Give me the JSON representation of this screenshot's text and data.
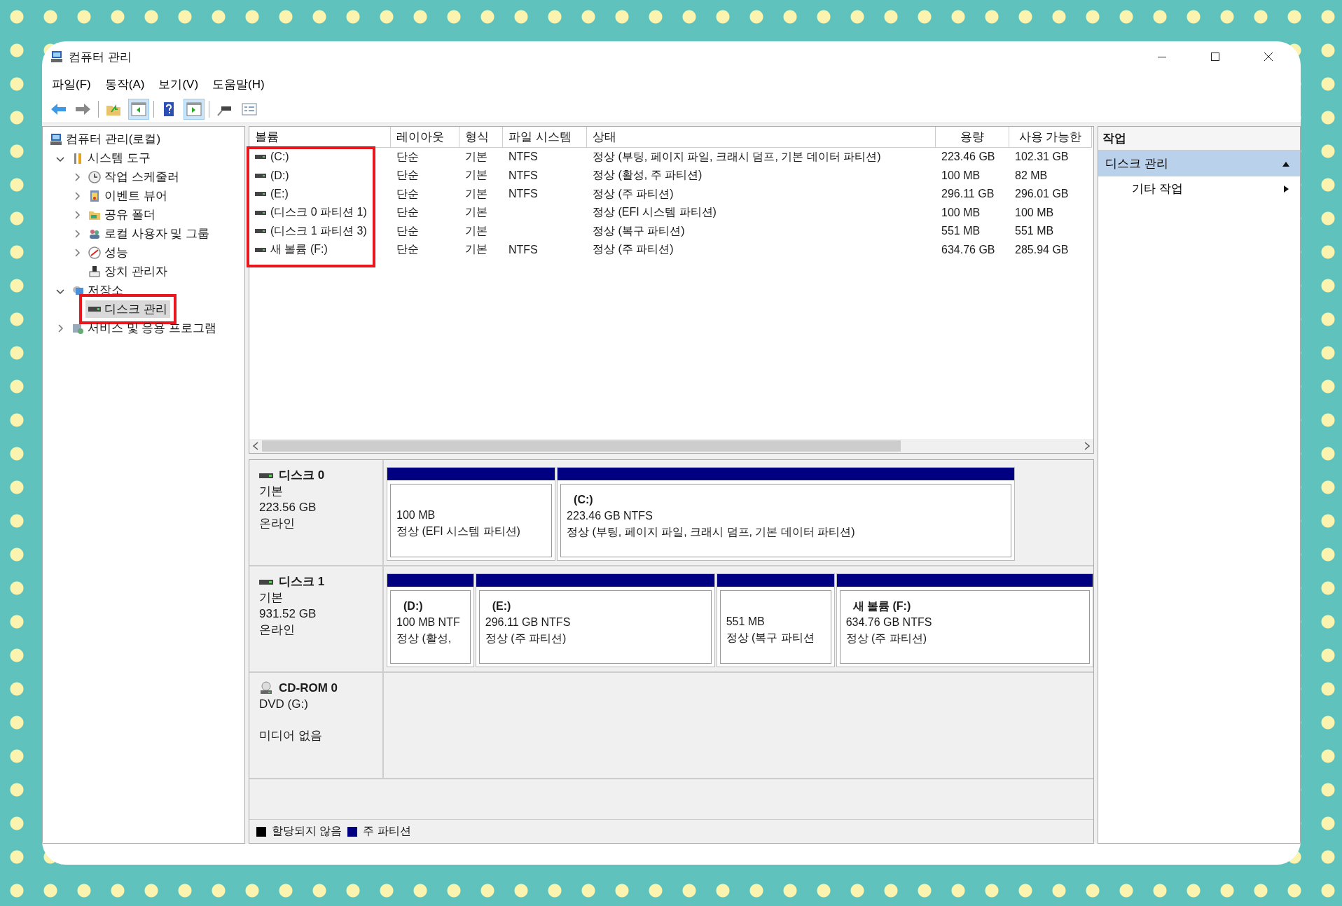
{
  "window": {
    "title": "컴퓨터 관리"
  },
  "menu": [
    {
      "label": "파일(F)"
    },
    {
      "label": "동작(A)"
    },
    {
      "label": "보기(V)"
    },
    {
      "label": "도움말(H)"
    }
  ],
  "toolbar": [
    [
      {
        "kind": "back",
        "pressed": false
      },
      {
        "kind": "forward",
        "pressed": false
      }
    ],
    [
      {
        "kind": "up",
        "pressed": false
      },
      {
        "kind": "tree-pane",
        "pressed": true
      }
    ],
    [
      {
        "kind": "help",
        "pressed": false
      },
      {
        "kind": "action-pane",
        "pressed": true
      }
    ],
    [
      {
        "kind": "connect",
        "pressed": false
      },
      {
        "kind": "properties",
        "pressed": false
      }
    ]
  ],
  "tree": [
    {
      "label": "컴퓨터 관리(로컬)",
      "kind": "computer",
      "selected": false,
      "highlighted": false,
      "children": [
        {
          "label": "시스템 도구",
          "kind": "tools",
          "expanded": true,
          "selected": false,
          "highlighted": false,
          "children": [
            {
              "label": "작업 스케줄러",
              "kind": "clock",
              "expanded": false,
              "selected": false,
              "highlighted": false
            },
            {
              "label": "이벤트 뷰어",
              "kind": "log",
              "expanded": false,
              "selected": false,
              "highlighted": false
            },
            {
              "label": "공유 폴더",
              "kind": "folder",
              "expanded": false,
              "selected": false,
              "highlighted": false
            },
            {
              "label": "로컬 사용자 및 그룹",
              "kind": "users",
              "expanded": false,
              "selected": false,
              "highlighted": false
            },
            {
              "label": "성능",
              "kind": "gauge",
              "expanded": false,
              "selected": false,
              "highlighted": false
            },
            {
              "label": "장치 관리자",
              "kind": "device",
              "selected": false,
              "highlighted": false
            }
          ]
        },
        {
          "label": "저장소",
          "kind": "storage",
          "expanded": true,
          "selected": false,
          "highlighted": false,
          "children": [
            {
              "label": "디스크 관리",
              "kind": "disk",
              "selected": true,
              "highlighted": true
            }
          ]
        },
        {
          "label": "서비스 및 응용 프로그램",
          "kind": "services",
          "expanded": false,
          "selected": false,
          "highlighted": false
        }
      ]
    }
  ],
  "table": {
    "volume_column_highlighted": true,
    "columns": [
      "볼륨",
      "레이아웃",
      "형식",
      "파일 시스템",
      "상태",
      "용량",
      "사용 가능한"
    ],
    "rows": [
      {
        "volume": "(C:)",
        "layout": "단순",
        "type": "기본",
        "file_system": "NTFS",
        "status": "정상 (부팅, 페이지 파일, 크래시 덤프, 기본 데이터 파티션)",
        "capacity": "223.46 GB",
        "free": "102.31 GB"
      },
      {
        "volume": "(D:)",
        "layout": "단순",
        "type": "기본",
        "file_system": "NTFS",
        "status": "정상 (활성, 주 파티션)",
        "capacity": "100 MB",
        "free": "82 MB"
      },
      {
        "volume": "(E:)",
        "layout": "단순",
        "type": "기본",
        "file_system": "NTFS",
        "status": "정상 (주 파티션)",
        "capacity": "296.11 GB",
        "free": "296.01 GB"
      },
      {
        "volume": "(디스크 0 파티션 1)",
        "layout": "단순",
        "type": "기본",
        "status": "정상 (EFI 시스템 파티션)",
        "capacity": "100 MB",
        "free": "100 MB"
      },
      {
        "volume": "(디스크 1 파티션 3)",
        "layout": "단순",
        "type": "기본",
        "status": "정상 (복구 파티션)",
        "capacity": "551 MB",
        "free": "551 MB"
      },
      {
        "volume": "새 볼륨 (F:)",
        "layout": "단순",
        "type": "기본",
        "file_system": "NTFS",
        "status": "정상 (주 파티션)",
        "capacity": "634.76 GB",
        "free": "285.94 GB"
      }
    ]
  },
  "disks": [
    {
      "kind": "disk",
      "name": "디스크 0",
      "lines": [
        "기본",
        "223.56 GB",
        "온라인"
      ],
      "partitions": [
        {
          "size": "100 MB",
          "status": "정상 (EFI 시스템 파티션)"
        },
        {
          "title": "(C:)",
          "size": "223.46 GB NTFS",
          "status": "정상 (부팅, 페이지 파일, 크래시 덤프, 기본 데이터 파티션)"
        }
      ]
    },
    {
      "kind": "disk",
      "name": "디스크 1",
      "lines": [
        "기본",
        "931.52 GB",
        "온라인"
      ],
      "partitions": [
        {
          "title": "(D:)",
          "size": "100 MB NTF",
          "status": "정상 (활성,"
        },
        {
          "title": "(E:)",
          "size": "296.11 GB NTFS",
          "status": "정상 (주 파티션)"
        },
        {
          "size": "551 MB",
          "status": "정상 (복구 파티션"
        },
        {
          "title": "새 볼륨  (F:)",
          "size": "634.76 GB NTFS",
          "status": "정상 (주 파티션)"
        }
      ]
    },
    {
      "kind": "cdrom",
      "name": "CD-ROM 0",
      "lines": [
        "DVD (G:)",
        "미디어 없음"
      ]
    }
  ],
  "legend": [
    {
      "label": "할당되지 않음",
      "color": "#000000"
    },
    {
      "label": "주 파티션",
      "color": "#000080"
    }
  ],
  "actions": {
    "title": "작업",
    "section": {
      "label": "디스크 관리",
      "expanded": true
    },
    "items": [
      {
        "label": "기타 작업"
      }
    ]
  }
}
